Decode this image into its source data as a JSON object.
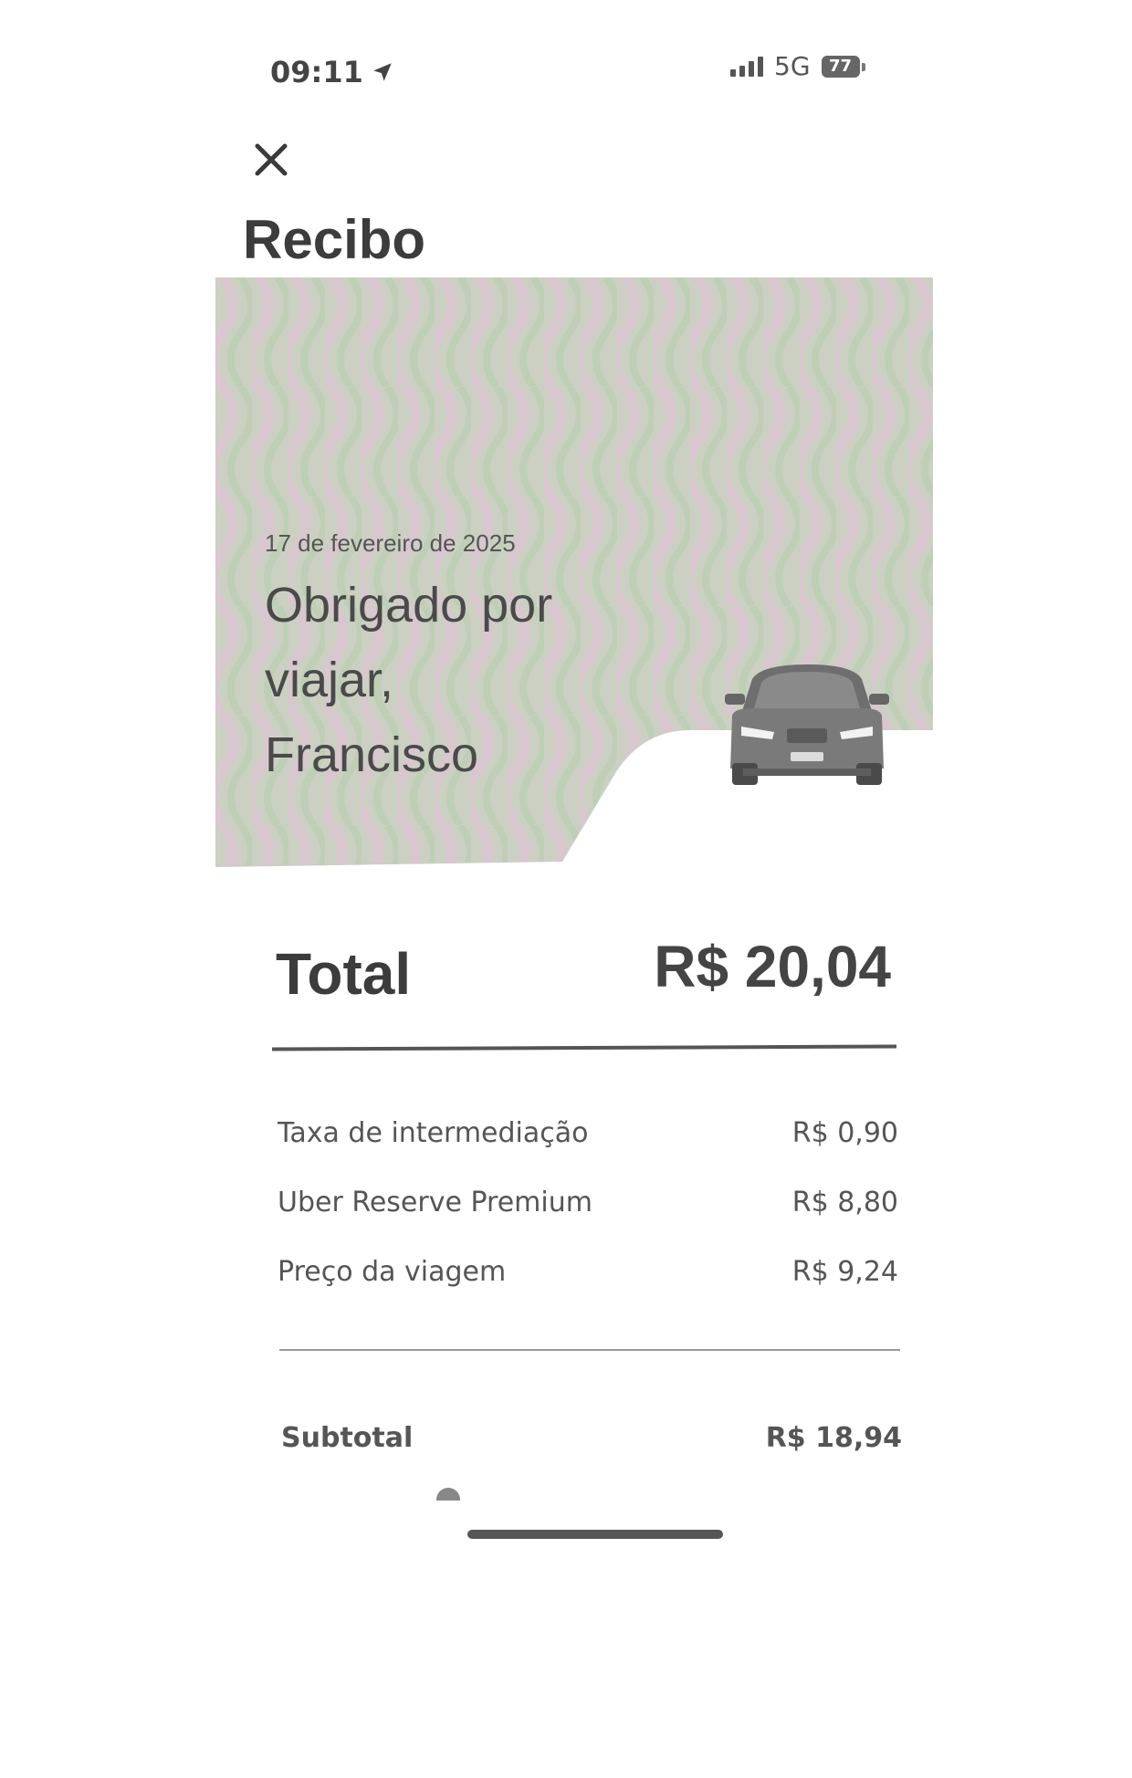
{
  "status_bar": {
    "time": "09:11",
    "network": "5G",
    "battery": "77",
    "icons": [
      "location-arrow-icon",
      "signal-icon",
      "battery-icon"
    ]
  },
  "header": {
    "close_icon": "close-icon",
    "title": "Recibo"
  },
  "hero": {
    "date": "17 de fevereiro de 2025",
    "message": "Obrigado por\nviajar,\nFrancisco",
    "illustration": "car-icon"
  },
  "total": {
    "label": "Total",
    "amount": "R$ 20,04"
  },
  "line_items": [
    {
      "label": "Taxa de intermediação",
      "amount": "R$ 0,90"
    },
    {
      "label": "Uber Reserve Premium",
      "amount": "R$ 8,80"
    },
    {
      "label": "Preço da viagem",
      "amount": "R$ 9,24"
    }
  ],
  "subtotal": {
    "label": "Subtotal",
    "amount": "R$ 18,94"
  },
  "colors": {
    "text": "#3c3c3c",
    "hero_green": "#c3cfb8",
    "hero_pink": "#d6c3cb",
    "car_body": "#777777"
  }
}
